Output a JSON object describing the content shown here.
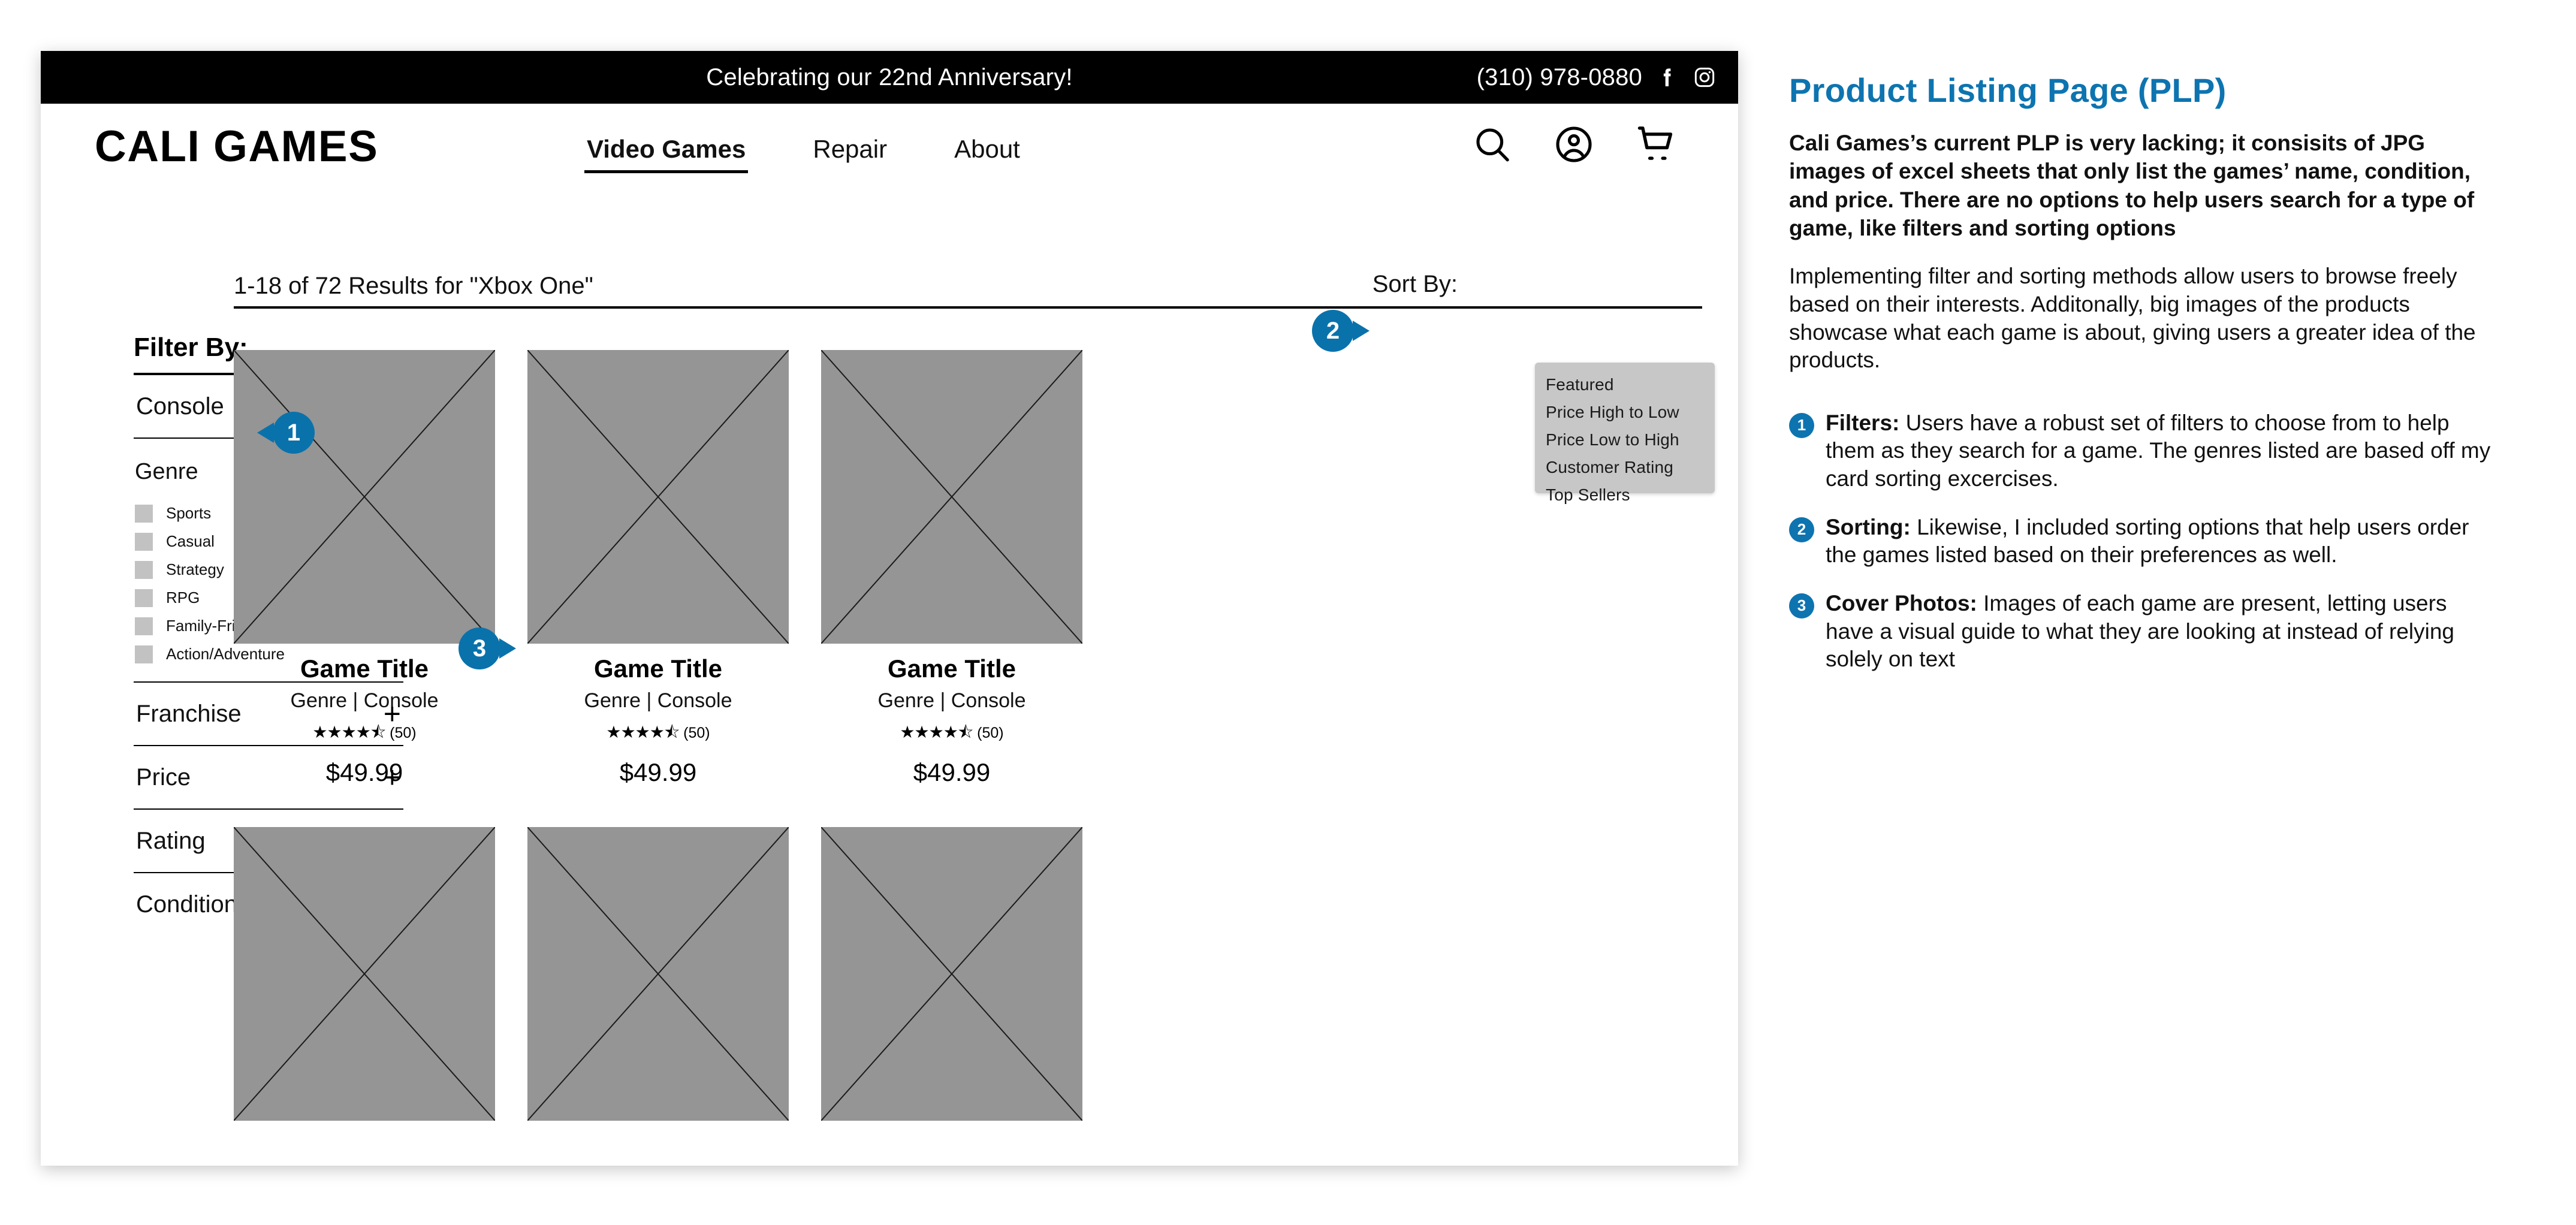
{
  "colors": {
    "accent_blue": "#0a72ab",
    "title_blue": "#0d74b0",
    "announce_bar": "#000000",
    "image_placeholder": "#959595",
    "dropdown_bg": "#c7c7c7",
    "checkbox": "#c2c2c2"
  },
  "wireframe": {
    "announcement": {
      "text": "Celebrating our 22nd Anniversary!",
      "phone": "(310) 978-0880",
      "social": [
        "facebook-icon",
        "instagram-icon"
      ]
    },
    "nav": {
      "logo": "CALI GAMES",
      "links": [
        {
          "label": "Video Games",
          "active": true
        },
        {
          "label": "Repair",
          "active": false
        },
        {
          "label": "About",
          "active": false
        }
      ],
      "icons": [
        "search-icon",
        "account-icon",
        "cart-icon"
      ]
    },
    "results": {
      "count_text": "1-18 of 72 Results for \"Xbox One\"",
      "sort_label": "Sort By:"
    },
    "sort_dropdown": {
      "options": [
        "Featured",
        "Price High to Low",
        "Price Low to High",
        "Customer Rating",
        "Top Sellers"
      ]
    },
    "filters": {
      "heading": "Filter By:",
      "console": {
        "label": "Console",
        "toggle": "+"
      },
      "genre": {
        "label": "Genre",
        "options": [
          "Sports",
          "Casual",
          "Strategy",
          "RPG",
          "Family-Friendly",
          "Action/Adventure"
        ]
      },
      "facets": [
        {
          "label": "Franchise",
          "toggle": "+"
        },
        {
          "label": "Price",
          "toggle": "+"
        },
        {
          "label": "Rating",
          "toggle": "+"
        },
        {
          "label": "Condition",
          "toggle": "+"
        }
      ]
    },
    "products": [
      {
        "title": "Game Title",
        "meta": "Genre  |  Console",
        "stars": "★★★★⯪",
        "reviews": "(50)",
        "price": "$49.99"
      },
      {
        "title": "Game Title",
        "meta": "Genre  |  Console",
        "stars": "★★★★⯪",
        "reviews": "(50)",
        "price": "$49.99"
      },
      {
        "title": "Game Title",
        "meta": "Genre  |  Console",
        "stars": "★★★★⯪",
        "reviews": "(50)",
        "price": "$49.99"
      }
    ],
    "badges": [
      {
        "num": "1",
        "target": "filter-by-heading"
      },
      {
        "num": "2",
        "target": "sort-by-label"
      },
      {
        "num": "3",
        "target": "product-image"
      }
    ]
  },
  "panel": {
    "title": "Product Listing Page (PLP)",
    "lead": "Cali Games’s current PLP is very lacking; it consisits of JPG images of excel sheets that only list the games’ name, condition, and price. There are no options to help users search for a type of game, like filters and sorting options",
    "body": "Implementing filter and sorting methods allow users to browse freely based on their interests. Additonally, big images of the products showcase what each game is about, giving users a greater idea of the products.",
    "notes": [
      {
        "num": "1",
        "label": "Filters:",
        "text": " Users have a robust set of filters to choose from to help them as they search for a game. The genres listed are based off my card sorting excercises."
      },
      {
        "num": "2",
        "label": "Sorting:",
        "text": " Likewise, I included sorting options that help users order the games listed based on their preferences as well."
      },
      {
        "num": "3",
        "label": "Cover Photos:",
        "text": " Images of each game are present, letting users have a visual guide to what they are looking at instead of relying solely on text"
      }
    ]
  }
}
